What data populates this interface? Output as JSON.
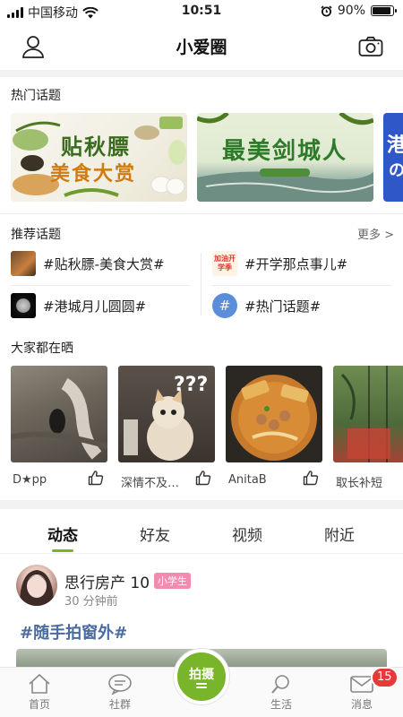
{
  "status_bar": {
    "carrier": "中国移动",
    "time": "10:51",
    "battery_percent": "90%",
    "battery_level": 0.9
  },
  "nav": {
    "title": "小爱圈",
    "left_icon": "user-icon",
    "right_icon": "camera-icon"
  },
  "hot_topics": {
    "title": "热门话题",
    "banners": [
      {
        "line1": "贴秋膘",
        "line2": "美食大赏"
      },
      {
        "line1": "最美剑城人"
      },
      {
        "line1": "港",
        "line2": "の"
      }
    ]
  },
  "recommended": {
    "title": "推荐话题",
    "more_label": "更多 >",
    "items": [
      {
        "label": "#贴秋膘-美食大赏#"
      },
      {
        "label": "#开学那点事儿#",
        "thumb_text": "加油开学季"
      },
      {
        "label": "#港城月儿圆圆#"
      },
      {
        "label": "#热门话题#",
        "thumb_text": "#"
      }
    ]
  },
  "feed_photos": {
    "title": "大家都在晒",
    "items": [
      {
        "user": "D★pp"
      },
      {
        "user": "深情不及…"
      },
      {
        "user": "AnitaB"
      },
      {
        "user": "取长补短"
      }
    ]
  },
  "tabs": {
    "items": [
      "动态",
      "好友",
      "视频",
      "附近"
    ],
    "active": "动态"
  },
  "post": {
    "author": "思行房产 10",
    "badge": "小学生",
    "time": "30 分钟前",
    "tag": "#随手拍窗外#"
  },
  "bottom_nav": {
    "items": [
      "首页",
      "社群",
      "生活",
      "消息"
    ],
    "center_label": "拍摄",
    "message_badge": "15"
  },
  "colors": {
    "accent": "#78b52a",
    "badge_red": "#e5393a",
    "tag_blue": "#4a6aa0",
    "badge_pink": "#f08cb0"
  }
}
